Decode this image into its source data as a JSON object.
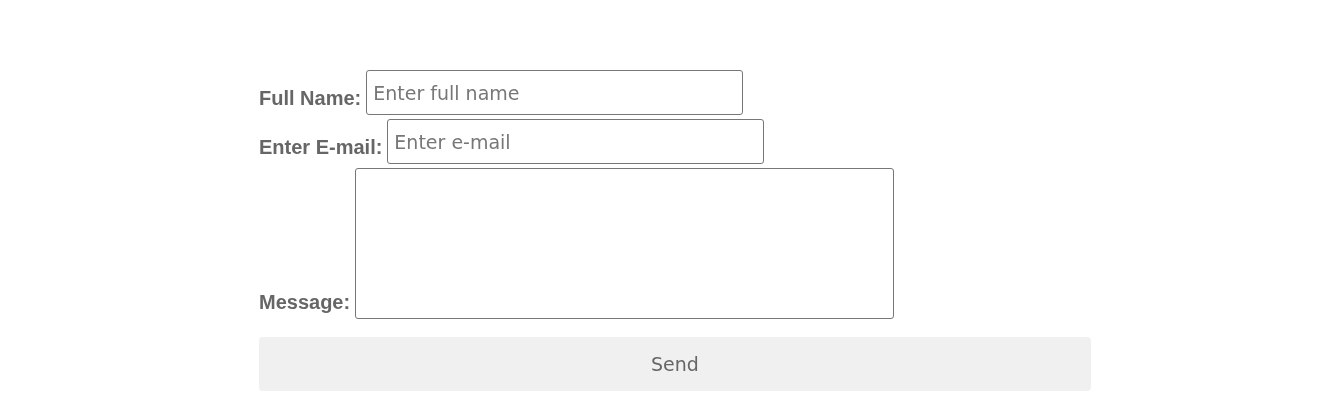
{
  "form": {
    "fields": [
      {
        "kind": "input",
        "label": "Full Name:",
        "placeholder": "Enter full name"
      },
      {
        "kind": "input",
        "label": "Enter E-mail:",
        "placeholder": "Enter e-mail"
      },
      {
        "kind": "textarea",
        "label": "Message:"
      }
    ],
    "submit_button": "Send"
  }
}
